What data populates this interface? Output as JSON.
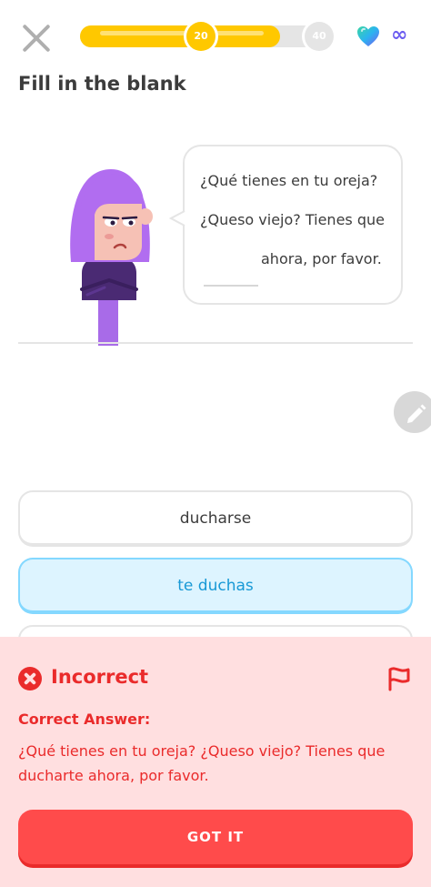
{
  "header": {
    "progress": {
      "current_milestone": "20",
      "next_milestone": "40",
      "fill_fraction": 0.79
    },
    "hearts_count": "∞",
    "icons": {
      "close": "close-icon",
      "heart": "heart-icon",
      "infinity": "infinity-icon"
    }
  },
  "challenge": {
    "title": "Fill in the blank",
    "bubble_lines": [
      "¿Qué tienes en tu oreja?",
      "¿Queso viejo? Tienes que",
      "ahora, por favor."
    ]
  },
  "options": [
    {
      "label": "ducharse",
      "selected": false
    },
    {
      "label": "te duchas",
      "selected": true
    },
    {
      "label": "",
      "selected": false
    }
  ],
  "feedback": {
    "status": "Incorrect",
    "correct_label": "Correct Answer:",
    "correct_text": "¿Qué tienes en tu oreja? ¿Queso viejo? Tienes que ducharte ahora, por favor.",
    "button_label": "GOT IT"
  },
  "colors": {
    "progress": "#ffc800",
    "selected_border": "#84d8ff",
    "selected_bg": "#ddf4ff",
    "error": "#ea2b2b",
    "error_bg": "#ffdfe0",
    "button": "#ff4b4b"
  }
}
